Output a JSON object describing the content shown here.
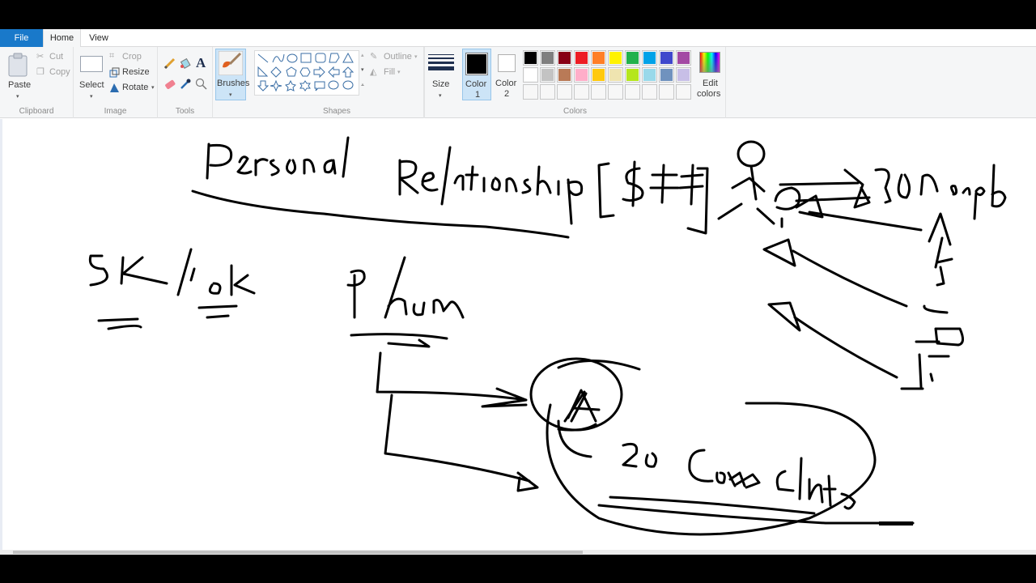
{
  "app": "Paint",
  "tabs": [
    {
      "label": "File"
    },
    {
      "label": "Home"
    },
    {
      "label": "View"
    }
  ],
  "ribbon": {
    "clipboard": {
      "label": "Clipboard",
      "paste": "Paste",
      "cut": "Cut",
      "copy": "Copy"
    },
    "image": {
      "label": "Image",
      "select": "Select",
      "crop": "Crop",
      "resize": "Resize",
      "rotate": "Rotate"
    },
    "tools": {
      "label": "Tools",
      "items": [
        "pencil",
        "fill",
        "text",
        "eraser",
        "color-picker",
        "magnifier"
      ]
    },
    "brushes": {
      "label": "Brushes"
    },
    "shapes": {
      "label": "Shapes",
      "outline": "Outline",
      "fill": "Fill"
    },
    "size": {
      "label": "Size"
    },
    "color1": {
      "label_line1": "Color",
      "label_line2": "1",
      "value": "#000000"
    },
    "color2": {
      "label_line1": "Color",
      "label_line2": "2",
      "value": "#ffffff"
    },
    "colors": {
      "label": "Colors",
      "row1": [
        "#000000",
        "#7f7f7f",
        "#880015",
        "#ed1c24",
        "#ff7f27",
        "#fff200",
        "#22b14c",
        "#00a2e8",
        "#3f48cc",
        "#a349a4"
      ],
      "row2": [
        "#ffffff",
        "#c3c3c3",
        "#b97a57",
        "#ffaec9",
        "#ffc90e",
        "#efe4b0",
        "#b5e61d",
        "#99d9ea",
        "#7092be",
        "#c8bfe7"
      ],
      "row3": [
        "#f7f7f7",
        "#f7f7f7",
        "#f7f7f7",
        "#f7f7f7",
        "#f7f7f7",
        "#f7f7f7",
        "#f7f7f7",
        "#f7f7f7",
        "#f7f7f7",
        "#f7f7f7"
      ]
    },
    "edit_colors": {
      "line1": "Edit",
      "line2": "colors"
    }
  },
  "canvas": {
    "handwritten_notes": [
      "Personal Relationship [$$$]",
      "5K/10K",
      "P hour",
      "20 People",
      "20 Consultants"
    ],
    "ink_color": "#000000"
  }
}
